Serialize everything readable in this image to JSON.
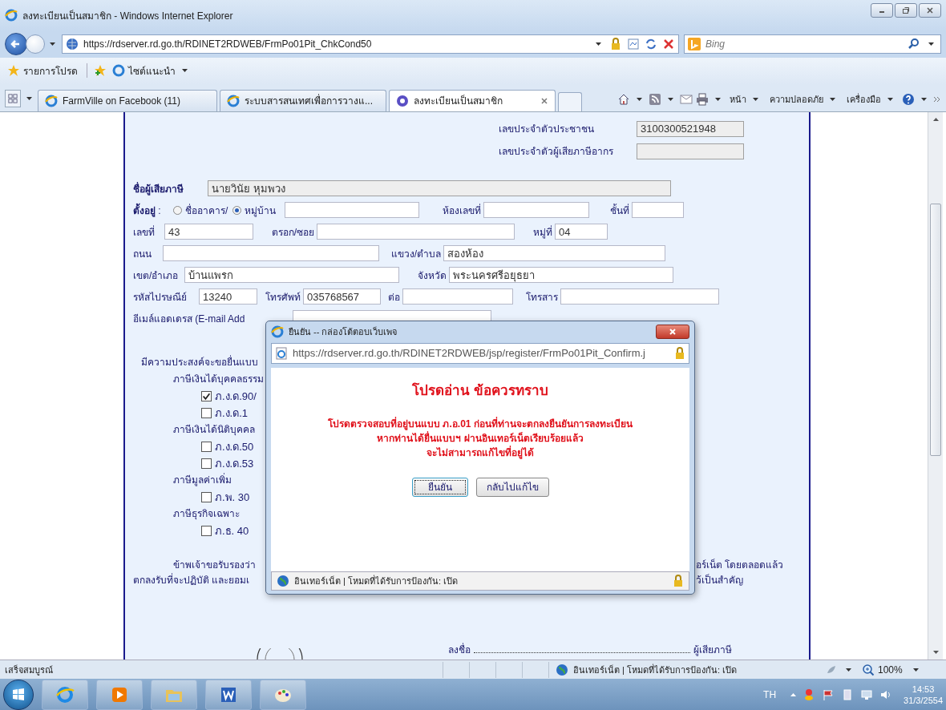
{
  "window": {
    "title": "ลงทะเบียนเป็นสมาชิก - Windows Internet Explorer"
  },
  "address_bar": {
    "url": "https://rdserver.rd.go.th/RDINET2RDWEB/FrmPo01Pit_ChkCond50"
  },
  "search": {
    "placeholder": "Bing"
  },
  "favorites_bar": {
    "favorites": "รายการโปรด",
    "suggested_sites": "ไซต์แนะนำ"
  },
  "tabs": [
    {
      "label": "FarmVille on Facebook (11)",
      "selected": false
    },
    {
      "label": "ระบบสารสนเทศเพื่อการวางแ...",
      "selected": false
    },
    {
      "label": "ลงทะเบียนเป็นสมาชิก",
      "selected": true
    }
  ],
  "command_bar": [
    "หน้า",
    "ความปลอดภัย",
    "เครื่องมือ"
  ],
  "page": {
    "id_fields": [
      {
        "label": "เลขประจำตัวประชาชน",
        "value": "3100300521948"
      },
      {
        "label": "เลขประจำตัวผู้เสียภาษีอากร"
      }
    ],
    "taxpayer": {
      "label": "ชื่อผู้เสียภาษี",
      "value": "นายวินัย หุมพวง"
    },
    "address": {
      "label": "**ตั้งอยู่** :",
      "radios": [
        {
          "label": "ชื่ออาคาร/",
          "selected": false
        },
        {
          "label": "หมู่บ้าน",
          "selected": true
        }
      ],
      "lines": [
        {
          "fields": [
            {
              "label": "ห้องเลขที่"
            },
            {
              "label": "ชั้นที่"
            }
          ]
        },
        {
          "fields": [
            {
              "label": "เลขที่",
              "value": "43"
            },
            {
              "label": "ตรอก/ซอย"
            },
            {
              "label": "หมู่ที่",
              "value": "04"
            }
          ]
        },
        {
          "fields": [
            {
              "label": "ถนน"
            },
            {
              "label": "แขวง/ตำบล",
              "value": "สองห้อง"
            }
          ]
        },
        {
          "fields": [
            {
              "label": "เขต/อำเภอ",
              "value": "บ้านแพรก"
            },
            {
              "label": "จังหวัด",
              "value": "พระนครศรีอยุธยา"
            }
          ]
        },
        {
          "fields": [
            {
              "label": "รหัสไปรษณีย์",
              "value": "13240"
            },
            {
              "label": "โทรศัพท์",
              "value": "035768567"
            },
            {
              "label": "ต่อ"
            },
            {
              "label": "โทรสาร"
            }
          ]
        },
        {
          "fields": [
            {
              "label": "อีเมล์แอดเดรส (E-mail Add"
            }
          ]
        }
      ]
    },
    "filing": {
      "intro": "มีความประสงค์จะขอยื่นแบบ",
      "groups": [
        {
          "title": "ภาษีเงินได้บุคคลธรรม",
          "items": [
            {
              "label": "ภ.ง.ด.90/",
              "checked": true
            },
            {
              "label": "ภ.ง.ด.1",
              "checked": false
            }
          ]
        },
        {
          "title": "ภาษีเงินได้นิติบุคคล",
          "items": [
            {
              "label": "ภ.ง.ด.50",
              "checked": false
            },
            {
              "label": "ภ.ง.ด.53",
              "checked": false
            }
          ]
        },
        {
          "title": "ภาษีมูลค่าเพิ่ม",
          "items": [
            {
              "label": "ภ.พ. 30",
              "checked": false
            }
          ]
        },
        {
          "title": "ภาษีธุรกิจเฉพาะ",
          "items": [
            {
              "label": "ภ.ธ. 40",
              "checked": false
            }
          ]
        }
      ]
    },
    "certification": {
      "left": [
        "ข้าพเจ้าขอรับรองว่า",
        "ตกลงรับที่จะปฏิบัติ และยอมเ"
      ],
      "right": [
        "อร์เน็ต โดยตลอดแล้ว",
        "ว้เป็นสำคัญ"
      ]
    },
    "signature": {
      "label": "ลงชื่อ",
      "role": "ผู้เสียภาษี"
    }
  },
  "dialog": {
    "title": "ยืนยัน -- กล่องโต้ตอบเว็บเพจ",
    "url": "https://rdserver.rd.go.th/RDINET2RDWEB/jsp/register/FrmPo01Pit_Confirm.j",
    "heading": "โปรดอ่าน ข้อควรทราบ",
    "message": [
      "โปรดตรวจสอบที่อยู่บนแบบ ภ.อ.01 ก่อนที่ท่านจะตกลงยืนยันการลงทะเบียน",
      "หากท่านได้ยื่นแบบฯ ผ่านอินเทอร์เน็ตเรียบร้อยแล้ว",
      "จะไม่สามารถแก้ไขที่อยู่ได้"
    ],
    "buttons": [
      {
        "label": "ยืนยัน",
        "focused": true
      },
      {
        "label": "กลับไปแก้ไข",
        "focused": false
      }
    ],
    "status": "อินเทอร์เน็ต | โหมดที่ได้รับการป้องกัน: เปิด"
  },
  "status_bar": {
    "text": "เสร็จสมบูรณ์",
    "zone": "อินเทอร์เน็ต | โหมดที่ได้รับการป้องกัน: เปิด",
    "zoom": "100%"
  },
  "taskbar": {
    "language": "TH",
    "time": "14:53",
    "date": "31/3/2554"
  }
}
